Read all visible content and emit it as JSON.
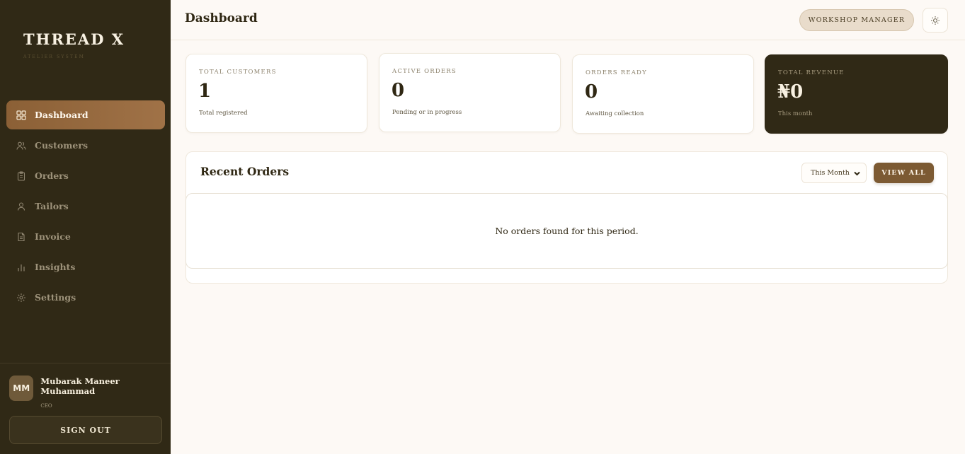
{
  "brand": {
    "title": "THREAD X",
    "subtitle": "ATELIER SYSTEM"
  },
  "sidebar": {
    "items": [
      {
        "label": "Dashboard",
        "icon": "grid-icon",
        "active": true
      },
      {
        "label": "Customers",
        "icon": "users-icon"
      },
      {
        "label": "Orders",
        "icon": "clipboard-icon"
      },
      {
        "label": "Tailors",
        "icon": "user-icon"
      },
      {
        "label": "Invoice",
        "icon": "file-icon"
      },
      {
        "label": "Insights",
        "icon": "bar-chart-icon"
      },
      {
        "label": "Settings",
        "icon": "gear-icon"
      }
    ]
  },
  "profile": {
    "initials": "MM",
    "name": "Mubarak Maneer Muhammad",
    "role": "CEO"
  },
  "signout_label": "SIGN OUT",
  "header": {
    "title": "Dashboard",
    "role_badge": "WORKSHOP MANAGER",
    "theme_icon": "sun-icon"
  },
  "stats": [
    {
      "label": "TOTAL CUSTOMERS",
      "value": "1",
      "sub": "Total registered"
    },
    {
      "label": "ACTIVE ORDERS",
      "value": "0",
      "sub": "Pending or in progress"
    },
    {
      "label": "ORDERS READY",
      "value": "0",
      "sub": "Awaiting collection"
    },
    {
      "label": "TOTAL REVENUE",
      "value": "₦0",
      "sub": "This month"
    }
  ],
  "recent_orders": {
    "title": "Recent Orders",
    "period": "This Month",
    "view_all_label": "VIEW ALL",
    "empty_message": "No orders found for this period."
  },
  "colors": {
    "sidebar_bg": "#302916",
    "accent": "#8b6036",
    "page_bg": "#fdf9f5"
  }
}
